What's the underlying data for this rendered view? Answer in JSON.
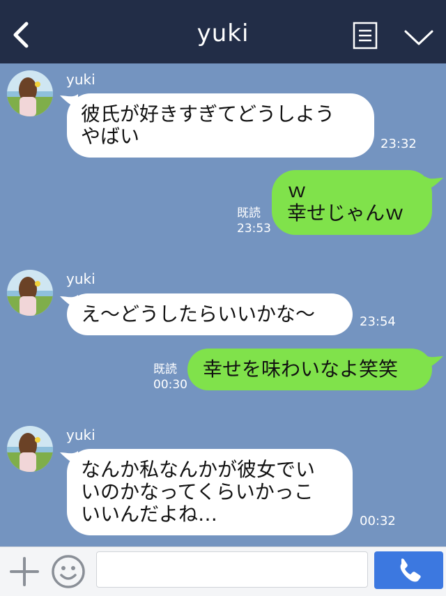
{
  "header": {
    "title": "yuki"
  },
  "messages": [
    {
      "sender": "yuki",
      "lines": [
        "彼氏が好きすぎてどうしよう",
        "やばい"
      ],
      "time": "23:32"
    },
    {
      "lines": [
        "ｗ",
        "幸せじゃんｗ"
      ],
      "read": "既読",
      "time": "23:53"
    },
    {
      "sender": "yuki",
      "lines": [
        "え～どうしたらいいかな～"
      ],
      "time": "23:54"
    },
    {
      "lines": [
        "幸せを味わいなよ笑笑"
      ],
      "read": "既読",
      "time": "00:30"
    },
    {
      "sender": "yuki",
      "lines": [
        "なんか私なんかが彼女でい",
        "いのかなってくらいかっこ",
        "いいんだよね…"
      ],
      "time": "00:32"
    }
  ],
  "colors": {
    "header_bg": "#222d47",
    "chat_bg": "#7494c0",
    "incoming_bubble": "#ffffff",
    "outgoing_bubble": "#80e24b",
    "send_button": "#3c78e0"
  },
  "icons": {
    "back": "chevron-left-icon",
    "menu": "menu-icon",
    "collapse": "chevron-down-icon",
    "add": "plus-icon",
    "emoji": "smiley-icon",
    "send": "phone-icon"
  }
}
